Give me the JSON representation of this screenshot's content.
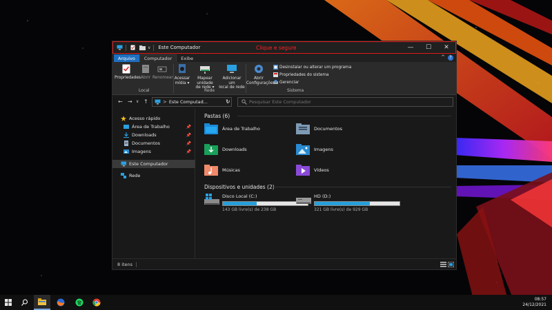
{
  "window": {
    "title": "Este Computador",
    "annotation": "Clique e segure",
    "controls": {
      "minimize": "—",
      "maximize": "☐",
      "close": "✕"
    },
    "quick_access_toolbar_dropdown": "∨"
  },
  "ribbon_tabs": [
    {
      "label": "Arquivo"
    },
    {
      "label": "Computador"
    },
    {
      "label": "Exibe"
    }
  ],
  "ribbon": {
    "help": "?",
    "collapse": "^",
    "local": {
      "label": "Local",
      "buttons": [
        "Propriedades",
        "Abrir",
        "Renomear"
      ]
    },
    "rede": {
      "label": "Rede",
      "buttons": [
        {
          "line1": "Acessar",
          "line2": "mídia ▾"
        },
        {
          "line1": "Mapear unidade",
          "line2": "de rede ▾"
        },
        {
          "line1": "Adicionar um",
          "line2": "local de rede"
        }
      ]
    },
    "sistema": {
      "label": "Sistema",
      "open_settings": {
        "line1": "Abrir",
        "line2": "Configurações"
      },
      "small": [
        "Desinstalar ou alterar um programa",
        "Propriedades do sistema",
        "Gerenciar"
      ]
    }
  },
  "navigation": {
    "back": "←",
    "forward": "→",
    "recent": "∨",
    "up": "↑",
    "address": "Este Computad...",
    "address_sep": ">",
    "refresh": "↻",
    "search_placeholder": "Pesquisar Este Computador"
  },
  "sidebar": {
    "quick_access": "Acesso rápido",
    "items": [
      {
        "label": "Área de Trabalho",
        "pin": "📌"
      },
      {
        "label": "Downloads",
        "pin": "📌"
      },
      {
        "label": "Documentos",
        "pin": "📌"
      },
      {
        "label": "Imagens",
        "pin": "📌"
      }
    ],
    "this_pc": "Este Computador",
    "network": "Rede"
  },
  "folders_section": {
    "title": "Pastas (6)",
    "folders": [
      "Área de Trabalho",
      "Documentos",
      "Downloads",
      "Imagens",
      "Músicas",
      "Vídeos"
    ]
  },
  "drives_section": {
    "title": "Dispositivos e unidades (2)",
    "drives": [
      {
        "name": "Disco Local (C:)",
        "free_text": "143 GB livre(s) de 238 GB",
        "used_fraction": 0.4
      },
      {
        "name": "HD (D:)",
        "free_text": "321 GB livre(s) de 929 GB",
        "used_fraction": 0.65
      }
    ]
  },
  "status": {
    "items": "8 itens"
  },
  "taskbar": {
    "time": "08:57",
    "date": "24/12/2021"
  },
  "colors": {
    "accent": "#1f6fbf",
    "annotation_red": "#e01818",
    "drive_bar": "#26a0da"
  }
}
